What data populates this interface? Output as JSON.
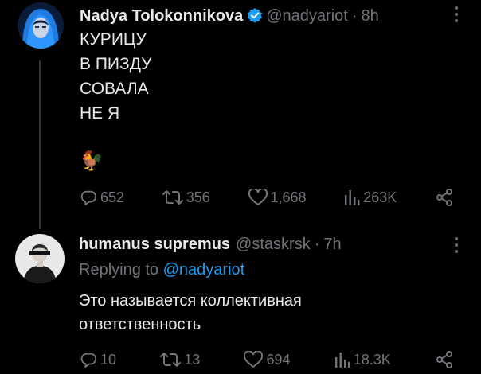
{
  "tweets": [
    {
      "author_name": "Nadya Tolokonnikova",
      "handle": "@nadyariot",
      "separator": "·",
      "time": "8h",
      "text": "КУРИЦУ\nВ ПИЗДУ\nСОВАЛА\nНЕ Я",
      "emoji": "🐓",
      "verified": true,
      "stats": {
        "replies": "652",
        "reposts": "356",
        "likes": "1,668",
        "views": "263K"
      }
    },
    {
      "author_name": "humanus supremus",
      "handle": "@staskrsk",
      "separator": "·",
      "time": "7h",
      "replying_prefix": "Replying to",
      "replying_to": "@nadyariot",
      "text": "Это называется коллективная\nответственность",
      "stats": {
        "replies": "10",
        "reposts": "13",
        "likes": "694",
        "views": "18.3K"
      }
    }
  ],
  "colors": {
    "background": "#000000",
    "text": "#e7e9ea",
    "muted": "#71767b",
    "link": "#1d9bf0",
    "verified": "#1d9bf0"
  },
  "icons": [
    "reply-icon",
    "repost-icon",
    "like-icon",
    "views-icon",
    "share-icon",
    "verified-badge-icon",
    "more-icon"
  ]
}
